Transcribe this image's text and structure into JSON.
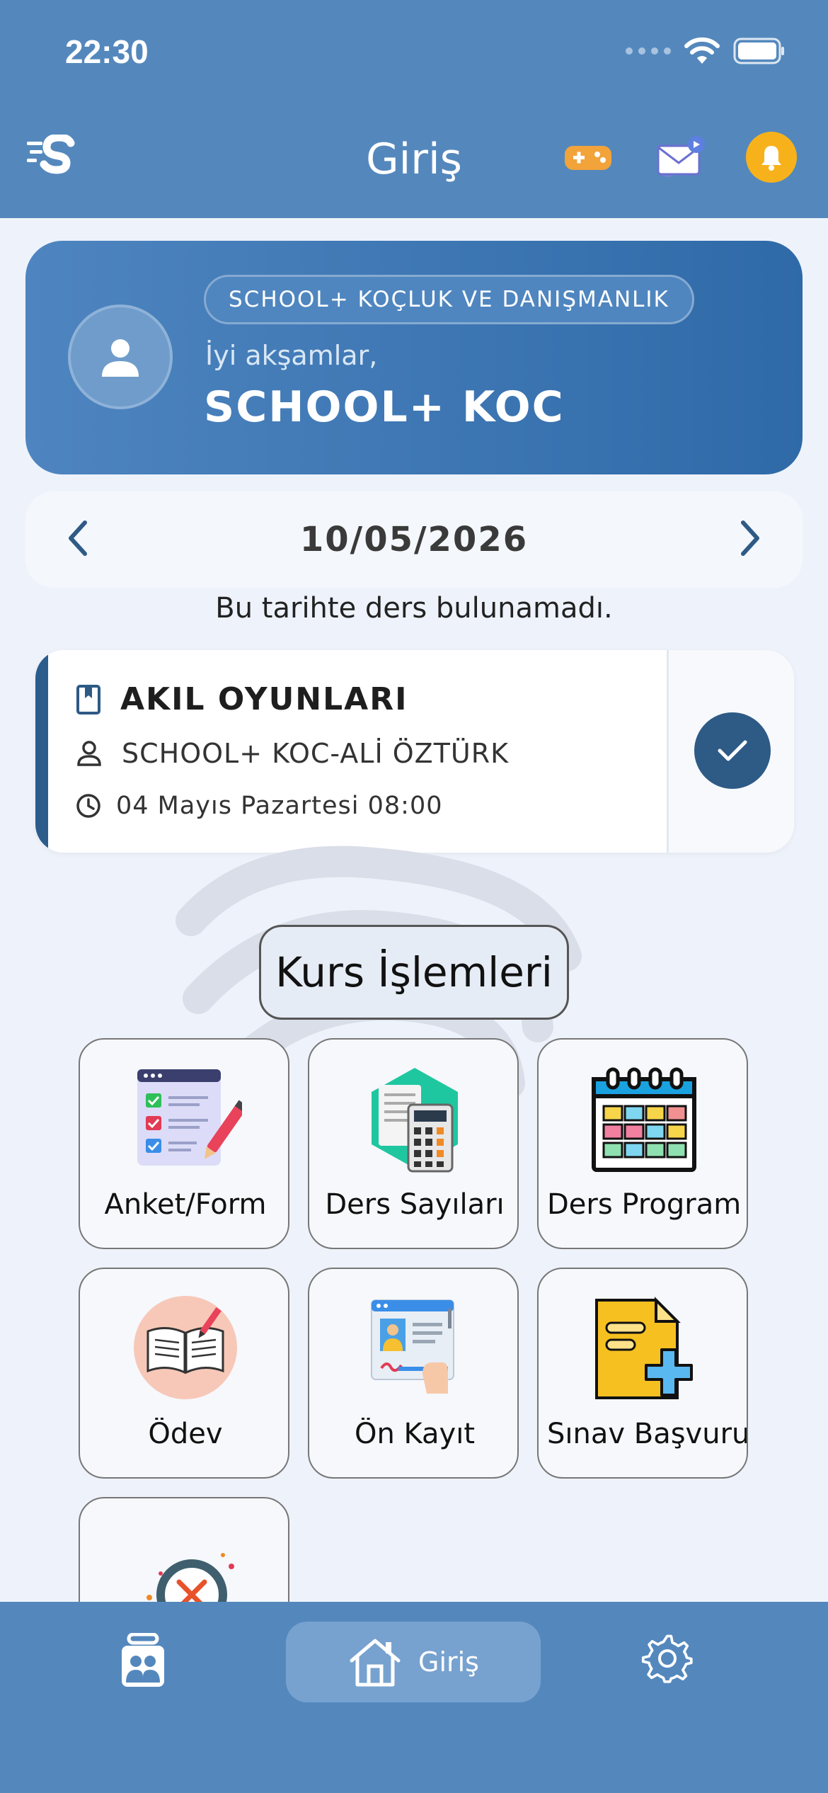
{
  "status_bar": {
    "time": "22:30"
  },
  "header": {
    "title": "Giriş"
  },
  "user_card": {
    "organization": "SCHOOL+ KOÇLUK VE DANIŞMANLIK",
    "greeting": "İyi akşamlar,",
    "name": "SCHOOL+ KOC"
  },
  "date_nav": {
    "date": "10/05/2026"
  },
  "no_lesson_text": "Bu tarihte ders bulunamadı.",
  "lesson": {
    "name": "AKIL OYUNLARI",
    "teacher": "SCHOOL+ KOC-ALİ ÖZTÜRK",
    "time": "04 Mayıs Pazartesi 08:00"
  },
  "section_title": "Kurs İşlemleri",
  "tiles": [
    {
      "label": "Anket/Form",
      "icon": "survey-form-icon"
    },
    {
      "label": "Ders Sayıları",
      "icon": "calculator-icon"
    },
    {
      "label": "Ders Program",
      "icon": "calendar-icon"
    },
    {
      "label": "Ödev",
      "icon": "book-icon"
    },
    {
      "label": "Ön Kayıt",
      "icon": "registration-icon"
    },
    {
      "label": "Sınav Başvuru",
      "icon": "exam-application-icon"
    },
    {
      "label": "",
      "icon": "absence-search-icon"
    }
  ],
  "bottom_nav": {
    "home_label": "Giriş"
  },
  "colors": {
    "primary": "#5488bd",
    "dark_blue": "#2e5a86",
    "bell": "#f7b21b",
    "background": "#eef3fb"
  }
}
